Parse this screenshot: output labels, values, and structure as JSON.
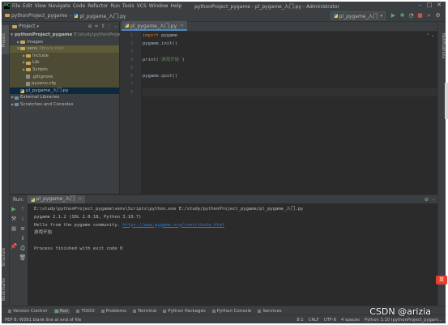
{
  "menu": {
    "items": [
      "File",
      "Edit",
      "View",
      "Navigate",
      "Code",
      "Refactor",
      "Run",
      "Tools",
      "VCS",
      "Window",
      "Help"
    ],
    "title": "pythonProject_pygame - pl_pygame_入门.py - Administrator"
  },
  "navbar": {
    "project": "pythonProject_pygame",
    "file": "pl_pygame_入门.py",
    "run_config": "pl_pygame_入门"
  },
  "project_panel": {
    "header": "Project",
    "tree": [
      {
        "label": "pythonProject_pygame",
        "extra": "E:\\study\\pythonProject_",
        "level": 0
      },
      {
        "label": "images",
        "extra": "",
        "level": 1
      },
      {
        "label": "venv",
        "extra": "library root",
        "level": 1
      },
      {
        "label": "Include",
        "extra": "",
        "level": 2
      },
      {
        "label": "Lib",
        "extra": "",
        "level": 2
      },
      {
        "label": "Scripts",
        "extra": "",
        "level": 2
      },
      {
        "label": ".gitignore",
        "extra": "",
        "level": 2
      },
      {
        "label": "pyvenv.cfg",
        "extra": "",
        "level": 2
      },
      {
        "label": "pl_pygame_入门.py",
        "extra": "",
        "level": 1
      },
      {
        "label": "External Libraries",
        "extra": "",
        "level": 0
      },
      {
        "label": "Scratches and Consoles",
        "extra": "",
        "level": 0
      }
    ]
  },
  "editor": {
    "tab": "pl_pygame_入门.py",
    "line_numbers": [
      "1",
      "2",
      "3",
      "4",
      "5",
      "6",
      "7",
      "8"
    ],
    "lines": {
      "l1_kw": "import",
      "l1_rest": " pygame",
      "l2": "pygame.init()",
      "l4_a": "print(",
      "l4_str": "'游戏开始'",
      "l4_b": ")",
      "l6": "pygame.quit()"
    }
  },
  "run": {
    "label": "Run:",
    "tab": "pl_pygame_入门",
    "console": [
      "E:\\study\\pythonProject_pygame\\venv\\Scripts\\python.exe E:/study/pythonProject_pygame/pl_pygame_入门.py",
      "pygame 2.1.2 (SDL 2.0.18, Python 3.10.7)",
      "Hello from the pygame community. ",
      "游戏开始",
      "",
      "Process finished with exit code 0"
    ],
    "link": "https://www.pygame.org/contribute.html"
  },
  "side_tabs": {
    "project": "Project",
    "structure": "Structure",
    "bookmarks": "Bookmarks",
    "notifications": "Notifications"
  },
  "bottom_tools": [
    "Version Control",
    "Run",
    "TODO",
    "Problems",
    "Terminal",
    "Python Packages",
    "Python Console",
    "Services"
  ],
  "status": {
    "message": "PEP 8: W391 blank line at end of file",
    "position": "8:1",
    "line_sep": "CRLF",
    "encoding": "UTF-8",
    "indent": "4 spaces",
    "interpreter": "Python 3.10 (pythonProject_pygam..."
  },
  "watermark": "CSDN @arizia",
  "ime_badge": "英"
}
